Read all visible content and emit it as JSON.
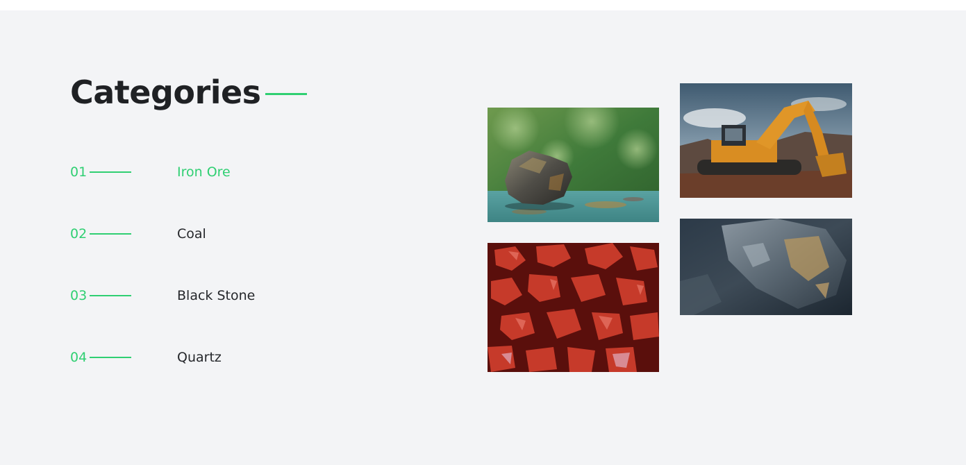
{
  "section": {
    "title": "Categories",
    "accent_color": "#2fcf72",
    "categories": [
      {
        "number": "01",
        "label": "Iron Ore",
        "active": true
      },
      {
        "number": "02",
        "label": "Coal",
        "active": false
      },
      {
        "number": "03",
        "label": "Black Stone",
        "active": false
      },
      {
        "number": "04",
        "label": "Quartz",
        "active": false
      }
    ]
  },
  "gallery": {
    "images": [
      {
        "icon": "iron-ore-rock-image"
      },
      {
        "icon": "excavator-image"
      },
      {
        "icon": "red-stones-image"
      },
      {
        "icon": "dark-rock-closeup-image"
      }
    ]
  }
}
